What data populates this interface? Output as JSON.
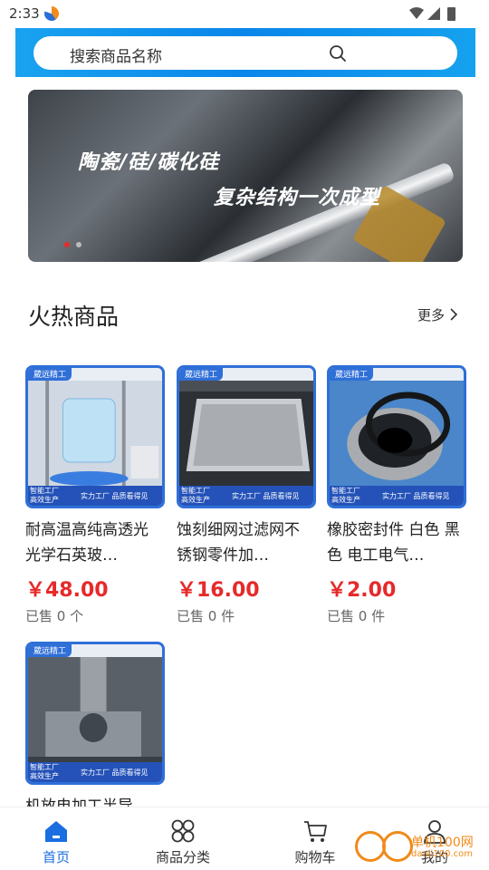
{
  "status_bar": {
    "time": "2:33"
  },
  "search": {
    "placeholder": "搜索商品名称"
  },
  "banner": {
    "line1": "陶瓷/硅/碳化硅",
    "line2": "复杂结构一次成型",
    "dots": [
      "active",
      "inactive"
    ]
  },
  "section": {
    "title": "火热商品",
    "more": "更多"
  },
  "badges": {
    "top": "葳远精工",
    "bottom_left_1": "智能工厂",
    "bottom_left_2": "高效生产",
    "bottom_right": "实力工厂 品质看得见"
  },
  "products": [
    {
      "name": "耐高温高纯高透光光学石英玻…",
      "price": "￥48.00",
      "sold": "已售 0 个"
    },
    {
      "name": "蚀刻细网过滤网不锈钢零件加…",
      "price": "￥16.00",
      "sold": "已售 0 件"
    },
    {
      "name": "橡胶密封件 白色 黑色 电工电气…",
      "price": "￥2.00",
      "sold": "已售 0 件"
    },
    {
      "name": "机放电加工半导",
      "price": "",
      "sold": ""
    }
  ],
  "nav": [
    {
      "label": "首页",
      "icon": "home-icon",
      "active": true
    },
    {
      "label": "商品分类",
      "icon": "grid-icon",
      "active": false
    },
    {
      "label": "购物车",
      "icon": "cart-icon",
      "active": false
    },
    {
      "label": "我的",
      "icon": "user-icon",
      "active": false
    }
  ],
  "watermark": {
    "text": "单机100网",
    "url": "danji100.com"
  },
  "colors": {
    "accent": "#1a6ee0",
    "price": "#e62a2a",
    "header": "#0a86ea"
  }
}
